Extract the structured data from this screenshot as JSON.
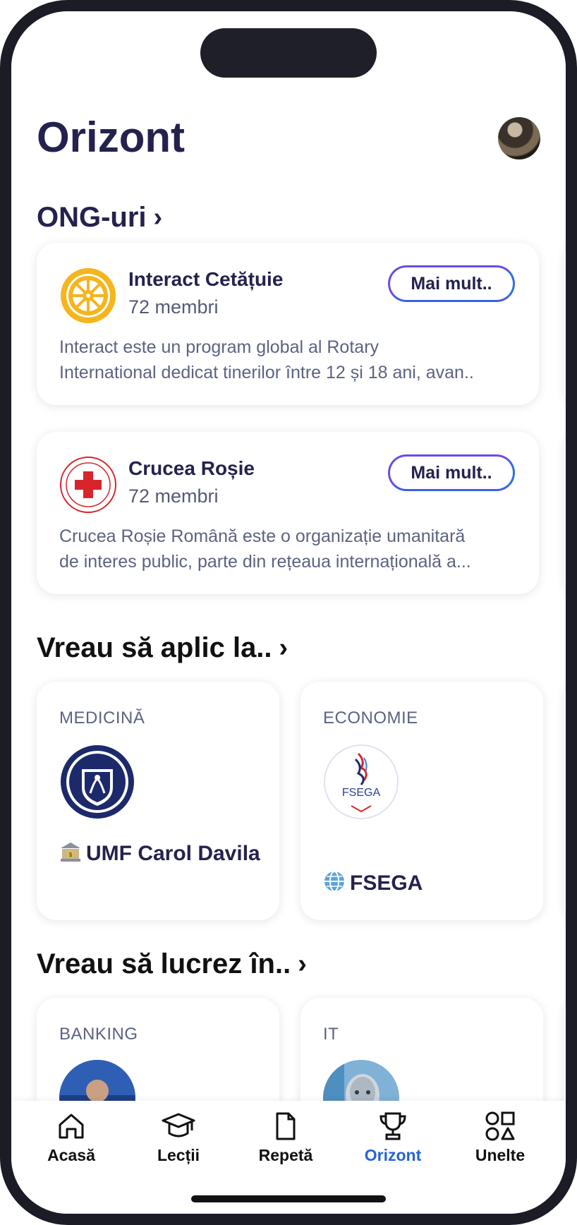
{
  "header": {
    "title": "Orizont"
  },
  "sections": {
    "ong": {
      "title": "ONG-uri",
      "chevron": "›"
    },
    "aplic": {
      "title": "Vreau să aplic la..",
      "chevron": "›"
    },
    "lucrez": {
      "title": "Vreau să lucrez în..",
      "chevron": "›"
    }
  },
  "ongs": [
    {
      "name": "Interact Cetățuie",
      "members": "72 membri",
      "button": "Mai mult..",
      "desc_line1": "Interact este un program global al Rotary",
      "desc_line2": "International dedicat tinerilor între 12 și 18 ani, avan..",
      "icon": "rotary-wheel-icon"
    },
    {
      "name": "Crucea Roșie",
      "members": "72 membri",
      "button": "Mai mult..",
      "desc_line1": "Crucea Roșie Română este o organizație umanitară",
      "desc_line2": "de interes public, parte din rețeaua internațională a...",
      "icon": "red-cross-icon"
    }
  ],
  "universities": [
    {
      "category": "MEDICINĂ",
      "name": "UMF Carol Davila",
      "icon": "bank-icon",
      "logo": "umf-logo"
    },
    {
      "category": "ECONOMIE",
      "name": "FSEGA",
      "icon": "globe-icon",
      "logo": "fsega-logo"
    }
  ],
  "jobs": [
    {
      "category": "BANKING"
    },
    {
      "category": "IT"
    }
  ],
  "tabbar": {
    "items": [
      {
        "label": "Acasă",
        "icon": "home-icon"
      },
      {
        "label": "Lecții",
        "icon": "graduation-cap-icon"
      },
      {
        "label": "Repetă",
        "icon": "document-icon"
      },
      {
        "label": "Orizont",
        "icon": "trophy-icon",
        "active": true
      },
      {
        "label": "Unelte",
        "icon": "shapes-icon"
      }
    ]
  },
  "colors": {
    "primary_text": "#24224d",
    "active_tab": "#2563d6",
    "button_border": "#6a4de8"
  }
}
